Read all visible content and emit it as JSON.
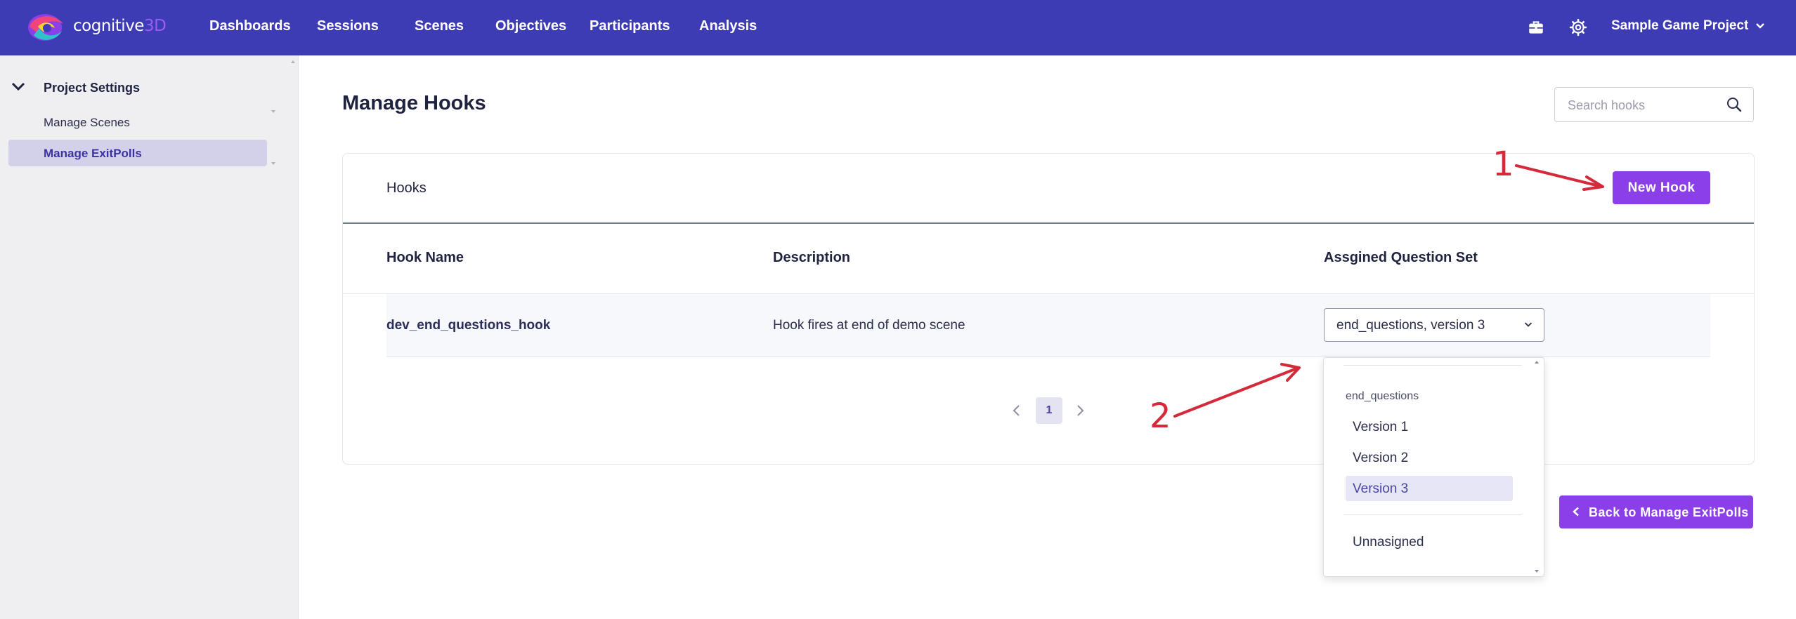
{
  "header": {
    "brand_prefix": "cognitive",
    "brand_suffix": "3D",
    "nav": [
      "Dashboards",
      "Sessions",
      "Scenes",
      "Objectives",
      "Participants",
      "Analysis"
    ],
    "project_name": "Sample Game Project",
    "icons": [
      "briefcase-icon",
      "gear-icon",
      "chevron-down-icon"
    ]
  },
  "sidebar": {
    "section_label": "Project Settings",
    "items": [
      {
        "label": "Manage Scenes",
        "active": false
      },
      {
        "label": "Manage ExitPolls",
        "active": true
      }
    ]
  },
  "main": {
    "title": "Manage Hooks",
    "search_placeholder": "Search hooks",
    "card_title": "Hooks",
    "new_hook_label": "New Hook",
    "columns": [
      "Hook Name",
      "Description",
      "Assgined Question Set"
    ],
    "rows": [
      {
        "name": "dev_end_questions_hook",
        "description": "Hook fires at end of demo scene",
        "question_set": "end_questions, version 3"
      }
    ],
    "pagination": {
      "current_page": "1"
    },
    "back_label": "Back to Manage ExitPolls"
  },
  "dropdown": {
    "group_label": "end_questions",
    "options": [
      "Version 1",
      "Version 2",
      "Version 3"
    ],
    "selected": "Version 3",
    "unassigned_label": "Unnasigned"
  },
  "annotations": {
    "label_1": "1",
    "label_2": "2",
    "color": "#d42a3a"
  },
  "colors": {
    "header_bg": "#3e3cb5",
    "accent_purple": "#8a3fe8",
    "sidebar_bg": "#efeff1",
    "sidebar_active_bg": "#d3d1ea"
  }
}
